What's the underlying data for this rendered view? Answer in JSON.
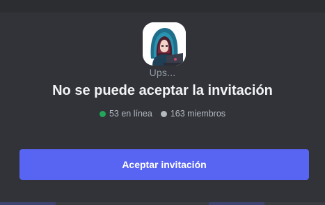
{
  "invite": {
    "subtitle": "Ups...",
    "title": "No se puede aceptar la invitación",
    "online_label": "53 en línea",
    "members_label": "163 miembros",
    "accept_label": "Aceptar invitación"
  },
  "colors": {
    "online_dot": "#23a55a",
    "members_dot": "#b5bac1",
    "button_bg": "#5865f2"
  },
  "server": {
    "icon": "hooded-avatar-with-laptop"
  }
}
